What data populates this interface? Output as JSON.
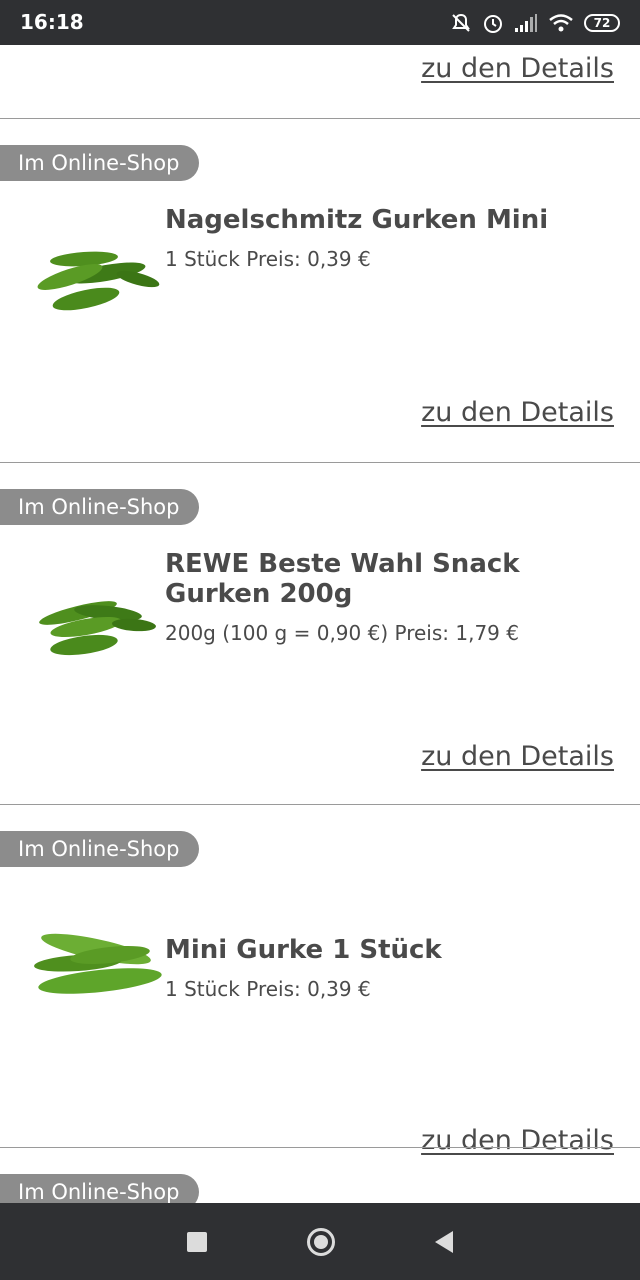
{
  "status_bar": {
    "time": "16:18",
    "battery": "72"
  },
  "top": {
    "details_label": "zu den Details"
  },
  "products": [
    {
      "badge": "Im Online-Shop",
      "title": "Nagelschmitz Gurken Mini",
      "price": "1 Stück Preis: 0,39 €",
      "details_label": "zu den Details"
    },
    {
      "badge": "Im Online-Shop",
      "title": "REWE Beste Wahl Snack Gurken 200g",
      "price": "200g (100 g = 0,90 €) Preis: 1,79 €",
      "details_label": "zu den Details"
    },
    {
      "badge": "Im Online-Shop",
      "title": "Mini Gurke 1 Stück",
      "price": "1 Stück Preis: 0,39 €",
      "details_label": "zu den Details"
    }
  ],
  "partial_badge": "Im Online-Shop",
  "icons": {
    "status": [
      "mute-icon",
      "alarm-icon",
      "signal-icon",
      "wifi-icon",
      "battery-icon"
    ],
    "nav": [
      "recents-icon",
      "home-icon",
      "back-icon"
    ]
  },
  "colors": {
    "bar": "#2f3033",
    "badge": "#8c8c8c"
  }
}
